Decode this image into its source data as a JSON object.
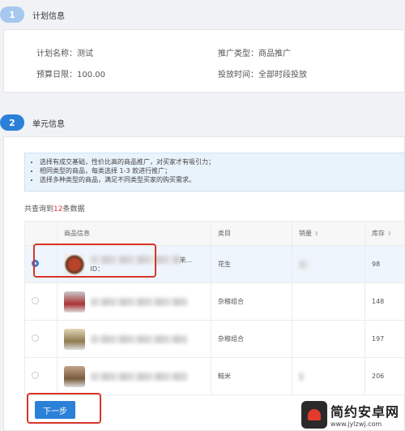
{
  "section1": {
    "badge": "1",
    "title": "计划信息",
    "plan_name_label": "计划名称：测试",
    "promo_type_label": "推广类型：商品推广",
    "budget_label": "预算日限：100.00",
    "time_label": "投放时间：全部时段投放"
  },
  "section2": {
    "badge": "2",
    "title": "单元信息",
    "tips": [
      "选择有成交基础，性价比高的商品推广，对买家才有吸引力；",
      "相同类型的商品，每类选择 1-3 款进行推广；",
      "选择多种类型的商品，满足不同类型买家的购买需求。"
    ],
    "count_prefix": "共查询到",
    "count_num": "12",
    "count_suffix": "条数据"
  },
  "table": {
    "headers": {
      "product": "商品信息",
      "category": "类目",
      "sales": "销量",
      "stock": "库存"
    },
    "rows": [
      {
        "id_label": "ID：",
        "name_tail": "茉...",
        "category": "花生",
        "stock": "98",
        "selected": true
      },
      {
        "category": "杂粮组合",
        "stock": "148",
        "selected": false
      },
      {
        "category": "杂粮组合",
        "stock": "197",
        "selected": false
      },
      {
        "category": "糙米",
        "stock": "206",
        "selected": false
      }
    ]
  },
  "next_button": "下一步",
  "watermark": {
    "title": "简约安卓网",
    "url": "www.jylzwj.com"
  },
  "colors": {
    "accent": "#2b80d8",
    "highlight": "#d9342b"
  }
}
